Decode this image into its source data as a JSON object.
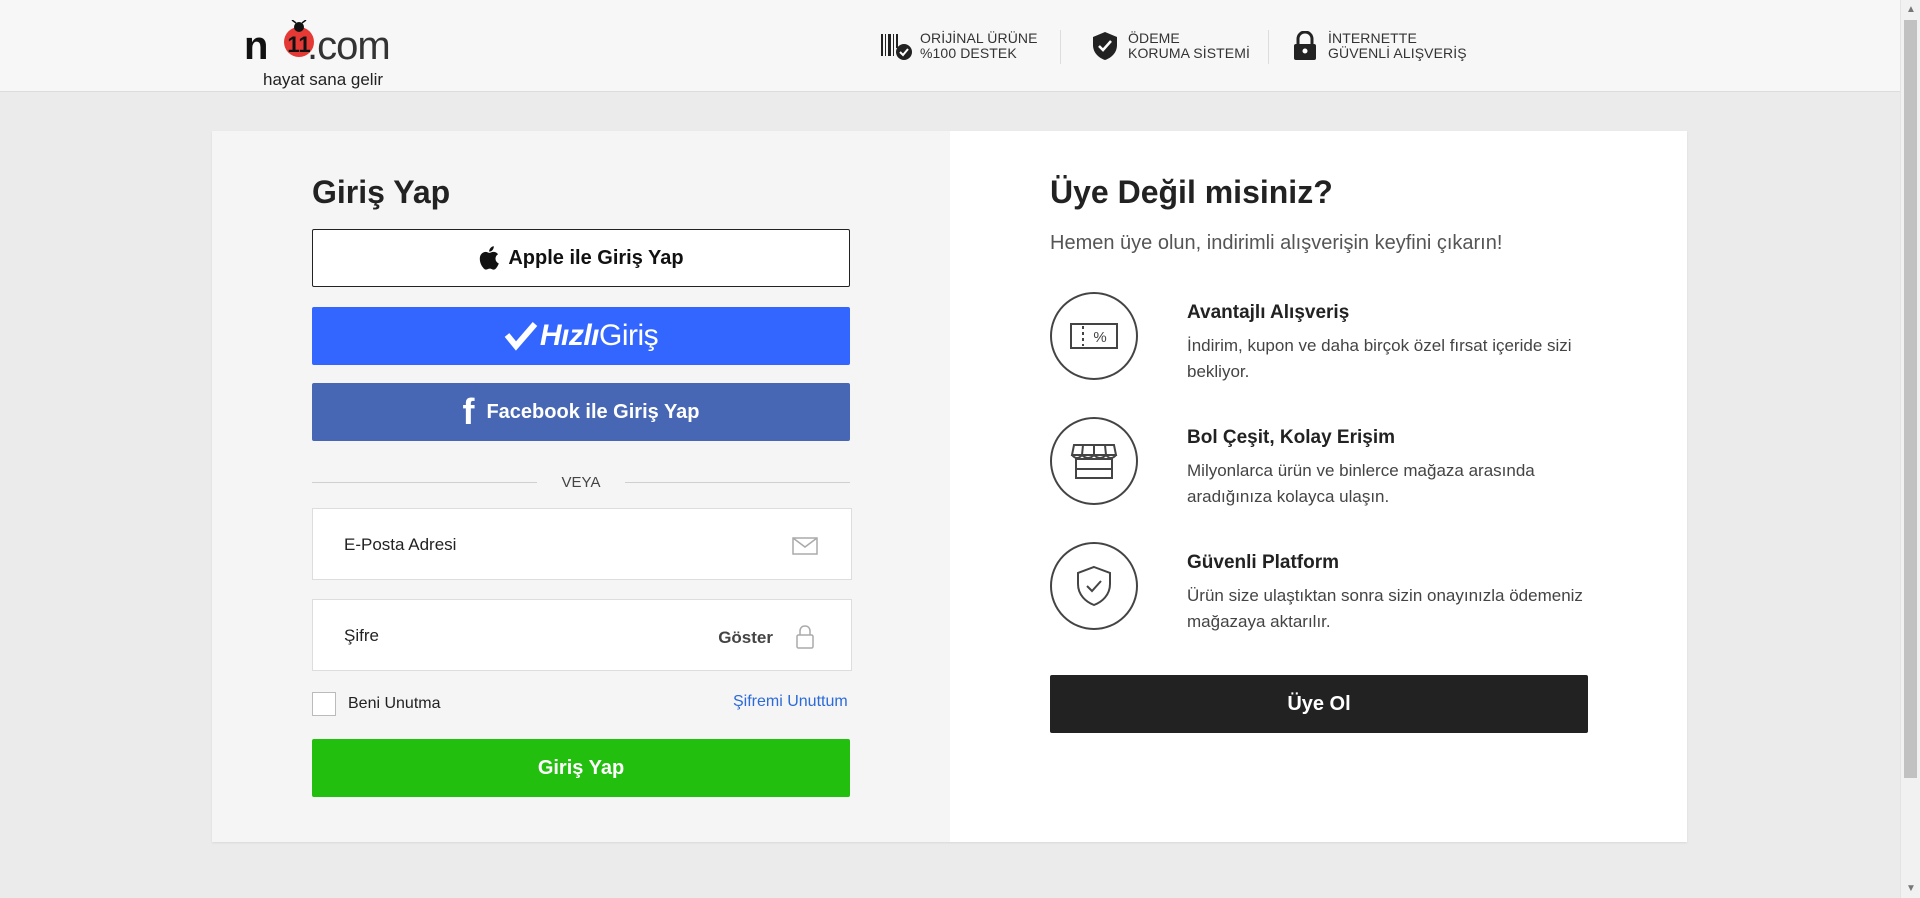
{
  "header": {
    "logo": {
      "brand_prefix": "n",
      "brand_digits": "11",
      "brand_suffix": ".com",
      "tagline": "hayat sana gelir"
    },
    "trust": [
      {
        "icon": "barcode-check-icon",
        "line1": "ORİJİNAL ÜRÜNE",
        "line2": "%100 DESTEK"
      },
      {
        "icon": "shield-check-icon",
        "line1": "ÖDEME",
        "line2": "KORUMA SİSTEMİ"
      },
      {
        "icon": "lock-icon",
        "line1": "İNTERNETTE",
        "line2": "GÜVENLİ ALIŞVERİŞ"
      }
    ]
  },
  "login": {
    "title": "Giriş Yap",
    "apple_label": "Apple ile Giriş Yap",
    "hizli_part1": "Hızlı",
    "hizli_part2": "Giriş",
    "facebook_label": "Facebook ile Giriş Yap",
    "facebook_glyph": "f",
    "divider": "VEYA",
    "email_placeholder": "E-Posta Adresi",
    "password_placeholder": "Şifre",
    "show_label": "Göster",
    "remember_label": "Beni Unutma",
    "forgot_label": "Şifremi Unuttum",
    "submit_label": "Giriş Yap"
  },
  "signup": {
    "title": "Üye Değil misiniz?",
    "subtitle": "Hemen üye olun, indirimli alışverişin keyfini çıkarın!",
    "features": [
      {
        "icon": "discount-ticket-icon",
        "title": "Avantajlı Alışveriş",
        "desc": "İndirim, kupon ve daha birçok özel fırsat içeride sizi bekliyor."
      },
      {
        "icon": "storefront-icon",
        "title": "Bol Çeşit, Kolay Erişim",
        "desc": "Milyonlarca ürün ve binlerce mağaza arasında aradığınıza kolayca ulaşın."
      },
      {
        "icon": "shield-check-icon",
        "title": "Güvenli Platform",
        "desc": "Ürün size ulaştıktan sonra sizin onayınızla ödemeniz mağazaya aktarılır."
      }
    ],
    "button_label": "Üye Ol"
  },
  "colors": {
    "hizli_blue": "#3366ff",
    "facebook_blue": "#4767b4",
    "login_green": "#23bf0f",
    "signup_dark": "#222222",
    "logo_red": "#e53935",
    "link_blue": "#2b6ad8"
  }
}
